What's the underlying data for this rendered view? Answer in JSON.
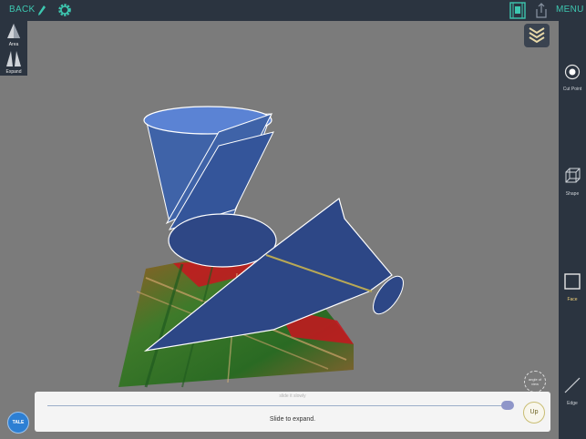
{
  "topbar": {
    "back_label": "BACK",
    "menu_label": "MENU",
    "accent_color": "#3dc7b0",
    "icons": [
      "pencil-icon",
      "gear-icon",
      "film-icon",
      "share-icon"
    ]
  },
  "left_tools": [
    {
      "label": "Area",
      "icon": "area-icon"
    },
    {
      "label": "Expand",
      "icon": "expand-icon"
    }
  ],
  "right_tools": [
    {
      "label": "Cut Point",
      "icon": "cut-point-icon",
      "active": false
    },
    {
      "label": "Shape",
      "icon": "cube-icon",
      "active": false
    },
    {
      "label": "Face",
      "icon": "square-icon",
      "active": true
    },
    {
      "label": "Edge",
      "icon": "line-icon",
      "active": false
    }
  ],
  "bottom": {
    "slider_hint": "slide it slowly",
    "slider_value": 0.99,
    "instruction": "Slide to expand.",
    "up_label": "Up"
  },
  "angle_label": "angle of view",
  "globe_label": "TALE"
}
